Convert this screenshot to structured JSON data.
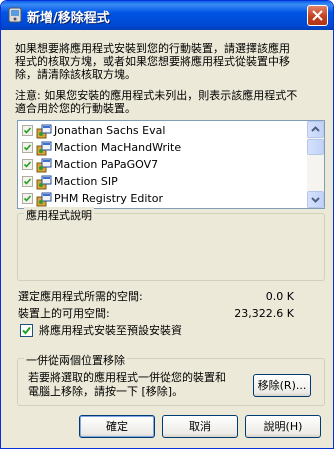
{
  "window": {
    "title": "新增/移除程式"
  },
  "intro_line1": "如果想要將應用程式安裝到您的行動裝置，請選擇該應用",
  "intro_line2": "程式的核取方塊，或者如果您想要將應用程式從裝置中移",
  "intro_line3": "除，請清除該核取方塊。",
  "note_line1": "注意: 如果您安裝的應用程式未列出，則表示該應用程式不",
  "note_line2": "適合用於您的行動裝置。",
  "programs": [
    {
      "name": "Jonathan Sachs Eval",
      "checked": true
    },
    {
      "name": "Maction MacHandWrite",
      "checked": true
    },
    {
      "name": "Maction PaPaGOV7",
      "checked": true
    },
    {
      "name": "Maction SIP",
      "checked": true
    },
    {
      "name": "PHM Registry Editor",
      "checked": true
    }
  ],
  "description": {
    "title": "應用程式說明"
  },
  "space": {
    "required_label": "選定應用程式所需的空間:",
    "required_value": "0.0 K",
    "available_label": "裝置上的可用空間:",
    "available_value": "23,322.6 K"
  },
  "install_default_label": "將應用程式安裝至預設安裝資",
  "install_default_checked": true,
  "remove_group": {
    "title": "一併從兩個位置移除",
    "text_line1": "若要將選取的應用程式一併從您的裝置和",
    "text_line2": "電腦上移除，請按一下 [移除]。",
    "button": "移除(R)..."
  },
  "buttons": {
    "ok": "確定",
    "cancel": "取消",
    "help": "說明(H)"
  },
  "colors": {
    "titlebar": "#0054e3",
    "window_bg": "#ece9d8",
    "check": "#21a121"
  }
}
